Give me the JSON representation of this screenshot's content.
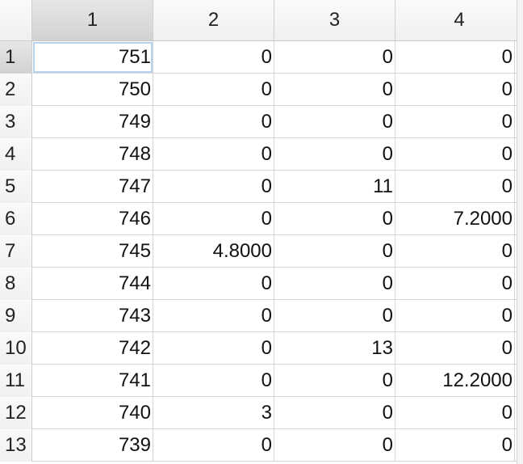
{
  "spreadsheet": {
    "column_headers": [
      "1",
      "2",
      "3",
      "4"
    ],
    "selected_column": "1",
    "selected_row": "1",
    "rows": [
      {
        "label": "1",
        "cells": [
          "751",
          "0",
          "0",
          "0"
        ]
      },
      {
        "label": "2",
        "cells": [
          "750",
          "0",
          "0",
          "0"
        ]
      },
      {
        "label": "3",
        "cells": [
          "749",
          "0",
          "0",
          "0"
        ]
      },
      {
        "label": "4",
        "cells": [
          "748",
          "0",
          "0",
          "0"
        ]
      },
      {
        "label": "5",
        "cells": [
          "747",
          "0",
          "11",
          "0"
        ]
      },
      {
        "label": "6",
        "cells": [
          "746",
          "0",
          "0",
          "7.2000"
        ]
      },
      {
        "label": "7",
        "cells": [
          "745",
          "4.8000",
          "0",
          "0"
        ]
      },
      {
        "label": "8",
        "cells": [
          "744",
          "0",
          "0",
          "0"
        ]
      },
      {
        "label": "9",
        "cells": [
          "743",
          "0",
          "0",
          "0"
        ]
      },
      {
        "label": "10",
        "cells": [
          "742",
          "0",
          "13",
          "0"
        ]
      },
      {
        "label": "11",
        "cells": [
          "741",
          "0",
          "0",
          "12.2000"
        ]
      },
      {
        "label": "12",
        "cells": [
          "740",
          "3",
          "0",
          "0"
        ]
      },
      {
        "label": "13",
        "cells": [
          "739",
          "0",
          "0",
          "0"
        ]
      }
    ]
  }
}
